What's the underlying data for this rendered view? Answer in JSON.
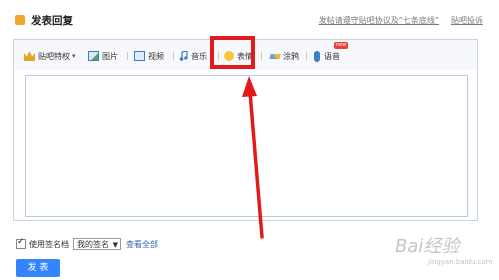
{
  "header": {
    "title": "发表回复",
    "rules_link": "发帖请遵守贴吧协议及“七条底线”",
    "complaint_link": "贴吧投诉"
  },
  "toolbar": {
    "items": [
      {
        "label": "贴吧特权",
        "icon": "crown-icon"
      },
      {
        "label": "图片",
        "icon": "image-icon"
      },
      {
        "label": "视频",
        "icon": "video-icon"
      },
      {
        "label": "音乐",
        "icon": "music-icon"
      },
      {
        "label": "表情",
        "icon": "smiley-icon"
      },
      {
        "label": "涂鸦",
        "icon": "brush-icon"
      },
      {
        "label": "语音",
        "icon": "microphone-icon"
      }
    ],
    "new_badge": "new",
    "highlighted_item": "表情"
  },
  "signature": {
    "checkbox_label": "使用签名档",
    "checked": true,
    "selected": "我的签名",
    "view_all": "查看全部"
  },
  "publish_button": "发 表",
  "watermark": {
    "text": "Bai经验",
    "sub": "jingyan.baidu.com"
  },
  "colors": {
    "highlight": "#e01b1b",
    "button": "#3385ff",
    "link": "#2d64b3"
  }
}
